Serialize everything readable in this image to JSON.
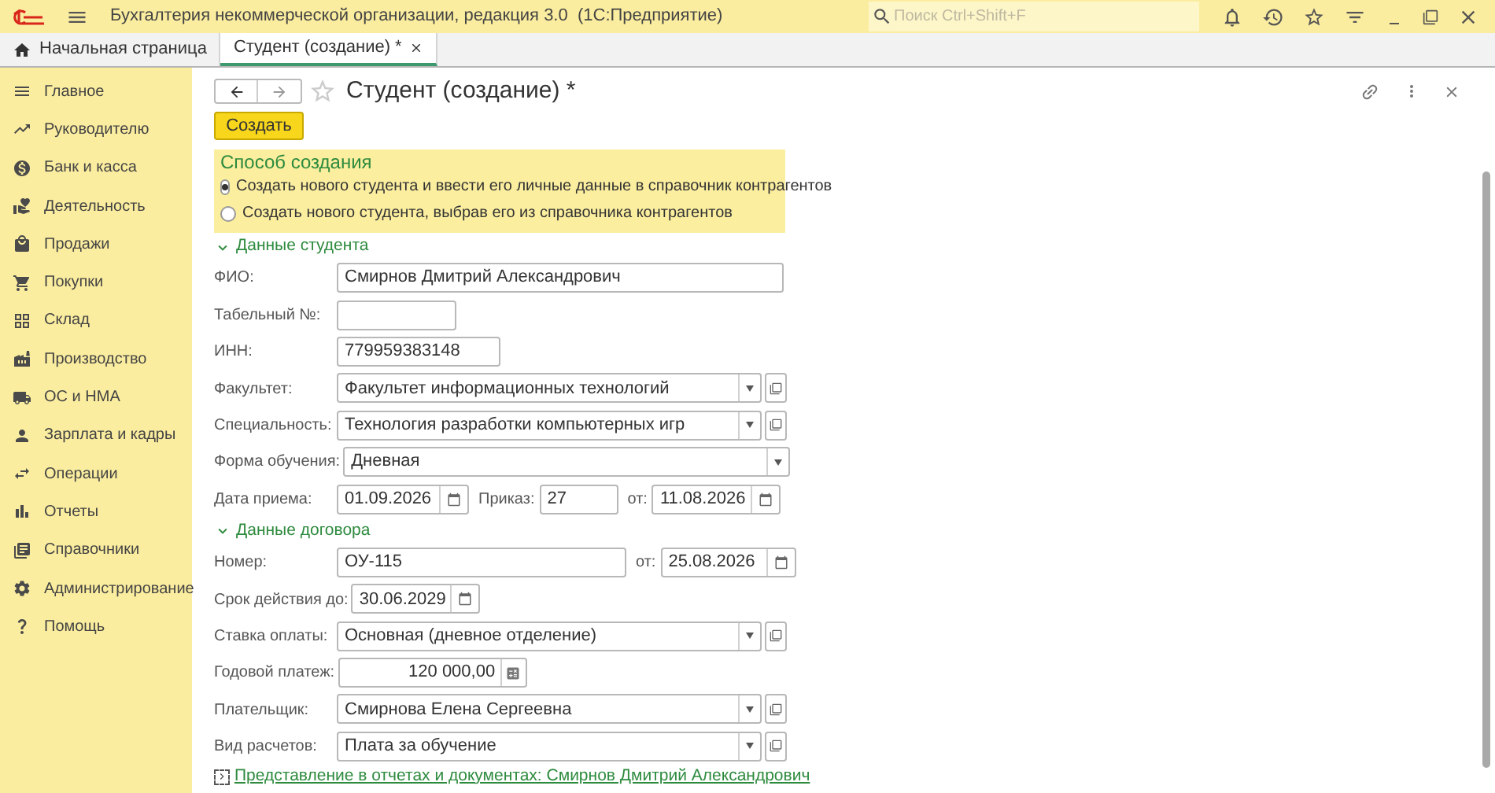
{
  "app": {
    "title": "Бухгалтерия некоммерческой организации, редакция 3.0  (1С:Предприятие)",
    "search_placeholder": "Поиск Ctrl+Shift+F"
  },
  "tabs": [
    {
      "label": "Начальная страница",
      "selected": false
    },
    {
      "label": "Студент (создание) *",
      "selected": true
    }
  ],
  "sidebar": {
    "items": [
      {
        "label": "Главное"
      },
      {
        "label": "Руководителю"
      },
      {
        "label": "Банк и касса"
      },
      {
        "label": "Деятельность"
      },
      {
        "label": "Продажи"
      },
      {
        "label": "Покупки"
      },
      {
        "label": "Склад"
      },
      {
        "label": "Производство"
      },
      {
        "label": "ОС и НМА"
      },
      {
        "label": "Зарплата и кадры"
      },
      {
        "label": "Операции"
      },
      {
        "label": "Отчеты"
      },
      {
        "label": "Справочники"
      },
      {
        "label": "Администрирование"
      },
      {
        "label": "Помощь"
      }
    ]
  },
  "form": {
    "title": "Студент (создание) *",
    "create_button": "Создать",
    "creation_method": {
      "title": "Способ создания",
      "options": [
        {
          "label": "Создать нового студента и ввести его личные данные в справочник контрагентов",
          "selected": true
        },
        {
          "label": "Создать нового студента, выбрав его из справочника контрагентов",
          "selected": false
        }
      ]
    },
    "sections": [
      {
        "title": "Данные студента",
        "expanded": true,
        "rows": [
          [
            {
              "kind": "label",
              "text": "ФИО:"
            },
            {
              "kind": "text",
              "value": "Смирнов Дмитрий Александрович"
            }
          ],
          [
            {
              "kind": "label",
              "text": "Табельный №:"
            },
            {
              "kind": "text"
            }
          ],
          [
            {
              "kind": "label",
              "text": "ИНН:"
            },
            {
              "kind": "text",
              "value": "779959383148"
            }
          ],
          [
            {
              "kind": "label",
              "text": "Факультет:"
            },
            {
              "kind": "select",
              "value": "Факультет информационных технологий",
              "open_button": true
            }
          ],
          [
            {
              "kind": "label",
              "text": "Специальность:"
            },
            {
              "kind": "select",
              "value": "Технология разработки компьютерных игр",
              "open_button": true
            }
          ],
          [
            {
              "kind": "label",
              "text": "Форма обучения:"
            },
            {
              "kind": "select",
              "value": "Дневная",
              "open_button": false
            }
          ],
          [
            {
              "kind": "label",
              "text": "Дата приема:"
            },
            {
              "kind": "date",
              "value": "01.09.2026"
            },
            {
              "kind": "label",
              "text": "Приказ:"
            },
            {
              "kind": "text",
              "value": "27"
            },
            {
              "kind": "label",
              "text": "от:"
            },
            {
              "kind": "date",
              "value": "11.08.2026"
            }
          ]
        ]
      },
      {
        "title": "Данные договора",
        "expanded": true,
        "rows": [
          [
            {
              "kind": "label",
              "text": "Номер:"
            },
            {
              "kind": "text",
              "value": "ОУ-115"
            },
            {
              "kind": "label",
              "text": "от:"
            },
            {
              "kind": "date",
              "value": "25.08.2026"
            }
          ],
          [
            {
              "kind": "label",
              "text": "Срок действия до:"
            },
            {
              "kind": "date",
              "value": "30.06.2029"
            }
          ],
          [
            {
              "kind": "label",
              "text": "Ставка оплаты:"
            },
            {
              "kind": "select",
              "value": "Основная (дневное отделение)",
              "open_button": true
            }
          ],
          [
            {
              "kind": "label",
              "text": "Годовой платеж:"
            },
            {
              "kind": "number",
              "value": "120 000,00"
            }
          ],
          [
            {
              "kind": "label",
              "text": "Плательщик:"
            },
            {
              "kind": "select",
              "value": "Смирнова Елена Сергеевна",
              "open_button": true
            }
          ],
          [
            {
              "kind": "label",
              "text": "Вид расчетов:"
            },
            {
              "kind": "select",
              "value": "Плата за обучение",
              "open_button": true
            }
          ]
        ]
      }
    ],
    "footer_link": {
      "label": "Представление в отчетах и документах: Смирнов Дмитрий Александрович",
      "expanded": false
    }
  }
}
